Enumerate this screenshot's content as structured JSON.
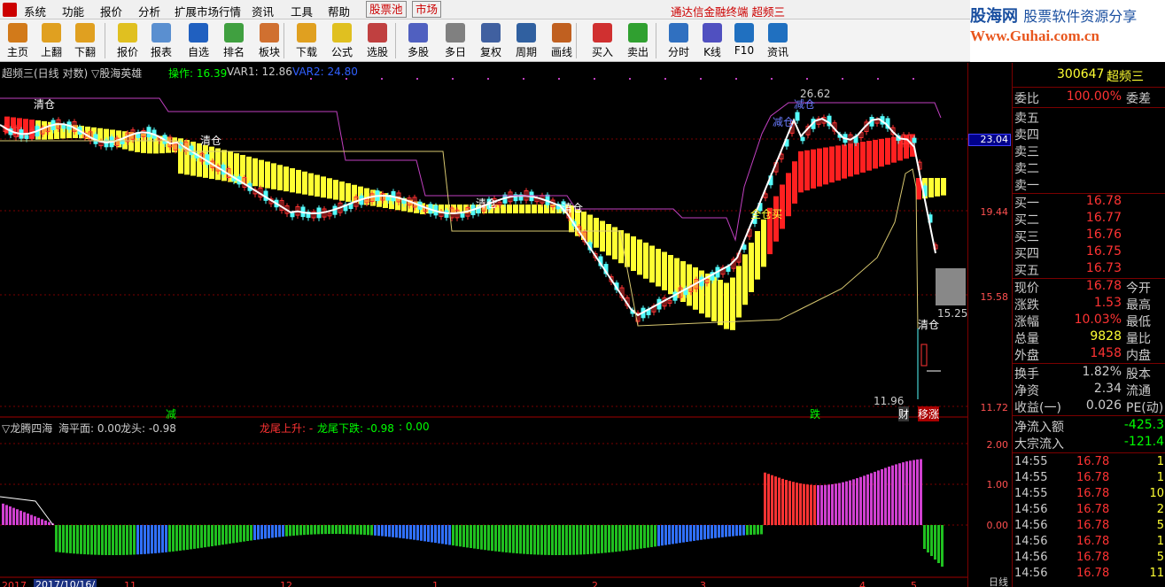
{
  "menu": {
    "items": [
      "系统",
      "功能",
      "报价",
      "分析",
      "扩展市场行情",
      "资讯",
      "工具",
      "帮助"
    ],
    "stock_pool": "股票池",
    "market": "市场",
    "window_title": "通达信金融终端  超频三"
  },
  "brand": {
    "name": "股海网",
    "slogan": "股票软件资源分享",
    "url": "Www.Guhai.com.cn"
  },
  "toolbar": [
    {
      "label": "主页",
      "icon": "home-icon"
    },
    {
      "label": "上翻",
      "icon": "arrow-up-icon"
    },
    {
      "label": "下翻",
      "icon": "arrow-down-icon"
    },
    {
      "label": "报价",
      "icon": "quote-icon"
    },
    {
      "label": "报表",
      "icon": "report-icon"
    },
    {
      "label": "自选",
      "icon": "f6-icon"
    },
    {
      "label": "排名",
      "icon": "rank-icon"
    },
    {
      "label": "板块",
      "icon": "sector-icon"
    },
    {
      "label": "下载",
      "icon": "download-icon"
    },
    {
      "label": "公式",
      "icon": "formula-icon"
    },
    {
      "label": "选股",
      "icon": "stock-picker-icon"
    },
    {
      "label": "多股",
      "icon": "multi-stock-icon"
    },
    {
      "label": "多日",
      "icon": "multi-day-icon"
    },
    {
      "label": "复权",
      "icon": "rights-adjust-icon"
    },
    {
      "label": "周期",
      "icon": "f8-icon"
    },
    {
      "label": "画线",
      "icon": "draw-line-icon"
    },
    {
      "label": "买入",
      "icon": "buy-icon"
    },
    {
      "label": "卖出",
      "icon": "sell-icon"
    },
    {
      "label": "分时",
      "icon": "intraday-icon"
    },
    {
      "label": "K线",
      "icon": "kline-icon"
    },
    {
      "label": "F10",
      "icon": "f10-icon"
    },
    {
      "label": "资讯",
      "icon": "info-icon"
    }
  ],
  "chart_header": {
    "title": "超频三(日线 对数)",
    "indicator": "▽股海英雄",
    "op_label": "操作: 16.39",
    "var1": "VAR1: 12.86",
    "var2": "VAR2: 24.80"
  },
  "sub_header": {
    "title": "▽龙腾四海",
    "sea_level": "海平面: 0.00",
    "dragon_head": "龙头: -0.98",
    "tail_up": "龙尾上升: -",
    "tail_down": "龙尾下跌: -0.98",
    "extra": ": 0.00"
  },
  "annotations": {
    "clear1": "清仓",
    "clear2": "清仓",
    "clear3": "清仓",
    "clear4": "清仓",
    "clear5": "清仓",
    "reduce": "减仓",
    "full_buy": "全仓买",
    "high": "26.62",
    "low": "11.96",
    "mark": "15.25",
    "sig_reduce": "减",
    "sig_drop": "跌",
    "sig_finance": "财",
    "sig_move": "移涨"
  },
  "scale": {
    "main": [
      "23.04",
      "19.44",
      "15.58",
      "11.72"
    ],
    "sub": [
      "2.00",
      "1.00",
      "0.00"
    ],
    "bottom": "日线"
  },
  "quote_panel": {
    "code": "300647",
    "name": "超频三",
    "wei_bi_label": "委比",
    "wei_bi": "100.00%",
    "wei_cha_label": "委差",
    "sell": [
      {
        "label": "卖五",
        "price": ""
      },
      {
        "label": "卖四",
        "price": ""
      },
      {
        "label": "卖三",
        "price": ""
      },
      {
        "label": "卖二",
        "price": ""
      },
      {
        "label": "卖一",
        "price": ""
      }
    ],
    "buy": [
      {
        "label": "买一",
        "price": "16.78"
      },
      {
        "label": "买二",
        "price": "16.77"
      },
      {
        "label": "买三",
        "price": "16.76"
      },
      {
        "label": "买四",
        "price": "16.75"
      },
      {
        "label": "买五",
        "price": "16.73"
      }
    ],
    "stats": [
      {
        "label": "现价",
        "value": "16.78",
        "right": "今开",
        "color": "#ff3333"
      },
      {
        "label": "涨跌",
        "value": "1.53",
        "right": "最高",
        "color": "#ff3333"
      },
      {
        "label": "涨幅",
        "value": "10.03%",
        "right": "最低",
        "color": "#ff3333"
      },
      {
        "label": "总量",
        "value": "9828",
        "right": "量比",
        "color": "#ffff33"
      },
      {
        "label": "外盘",
        "value": "1458",
        "right": "内盘",
        "color": "#ff3333"
      }
    ],
    "fin": [
      {
        "label": "换手",
        "value": "1.82%",
        "right": "股本"
      },
      {
        "label": "净资",
        "value": "2.34",
        "right": "流通"
      },
      {
        "label": "收益(一)",
        "value": "0.026",
        "right": "PE(动)"
      }
    ],
    "flow": [
      {
        "label": "净流入额",
        "value": "-425.3"
      },
      {
        "label": "大宗流入",
        "value": "-121.4"
      }
    ],
    "ticks": [
      {
        "time": "14:55",
        "price": "16.78",
        "vol": "1"
      },
      {
        "time": "14:55",
        "price": "16.78",
        "vol": "1"
      },
      {
        "time": "14:55",
        "price": "16.78",
        "vol": "10"
      },
      {
        "time": "14:56",
        "price": "16.78",
        "vol": "2"
      },
      {
        "time": "14:56",
        "price": "16.78",
        "vol": "5"
      },
      {
        "time": "14:56",
        "price": "16.78",
        "vol": "1"
      },
      {
        "time": "14:56",
        "price": "16.78",
        "vol": "5"
      },
      {
        "time": "14:56",
        "price": "16.78",
        "vol": "11"
      }
    ]
  },
  "date_bar": {
    "year": "2017",
    "date": "2017/10/16/",
    "months": [
      "11",
      "12",
      "1",
      "2",
      "3",
      "4",
      "5"
    ]
  }
}
